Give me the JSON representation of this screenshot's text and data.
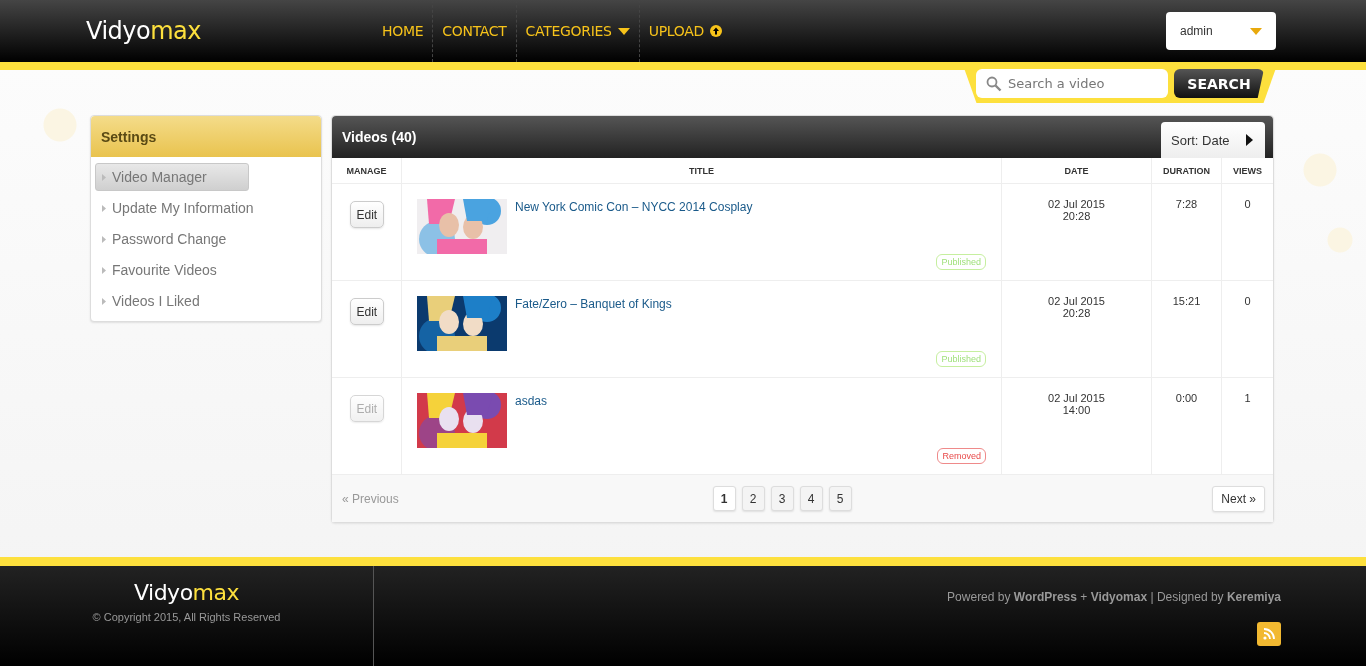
{
  "header": {
    "logo": {
      "first": "Vidyo",
      "second": "max"
    },
    "nav": [
      {
        "label": "HOME",
        "kind": "link"
      },
      {
        "label": "CONTACT",
        "kind": "link"
      },
      {
        "label": "CATEGORIES",
        "kind": "dropdown"
      },
      {
        "label": "UPLOAD",
        "kind": "upload"
      }
    ],
    "user_menu": {
      "value": "admin"
    }
  },
  "search": {
    "placeholder": "Search a video",
    "button": "SEARCH"
  },
  "sidebar": {
    "title": "Settings",
    "items": [
      {
        "label": "Video Manager",
        "selected": true
      },
      {
        "label": "Update My Information",
        "selected": false
      },
      {
        "label": "Password Change",
        "selected": false
      },
      {
        "label": "Favourite Videos",
        "selected": false
      },
      {
        "label": "Videos I Liked",
        "selected": false
      }
    ]
  },
  "videos": {
    "title": "Videos (40)",
    "sort": "Sort: Date",
    "columns": [
      "MANAGE",
      "TITLE",
      "DATE",
      "DURATION",
      "VIEWS"
    ],
    "rows": [
      {
        "edit": "Edit",
        "disabled": false,
        "title": "New York Comic Con – NYCC 2014 Cosplay",
        "status": {
          "kind": "published",
          "label": "Published"
        },
        "date": "02 Jul 2015",
        "time": "20:28",
        "duration": "7:28",
        "views": "0"
      },
      {
        "edit": "Edit",
        "disabled": false,
        "title": "Fate/Zero – Banquet of Kings",
        "status": {
          "kind": "published",
          "label": "Published"
        },
        "date": "02 Jul 2015",
        "time": "20:28",
        "duration": "15:21",
        "views": "0"
      },
      {
        "edit": "Edit",
        "disabled": true,
        "title": "asdas",
        "status": {
          "kind": "removed",
          "label": "Removed"
        },
        "date": "02 Jul 2015",
        "time": "14:00",
        "duration": "0:00",
        "views": "1"
      }
    ],
    "pagination": {
      "previous": {
        "label": "« Previous",
        "disabled": true
      },
      "pages": [
        {
          "label": "1",
          "selected": true
        },
        {
          "label": "2",
          "selected": false
        },
        {
          "label": "3",
          "selected": false
        },
        {
          "label": "4",
          "selected": false
        },
        {
          "label": "5",
          "selected": false
        }
      ],
      "next": {
        "label": "Next »",
        "disabled": false
      }
    }
  },
  "footer": {
    "logo": {
      "first": "Vidyo",
      "second": "max"
    },
    "copyright": "© Copyright 2015, All Rights Reserved",
    "credits": "Powered by **WordPress** + **Vidyomax** | Designed by **Keremiya**"
  }
}
